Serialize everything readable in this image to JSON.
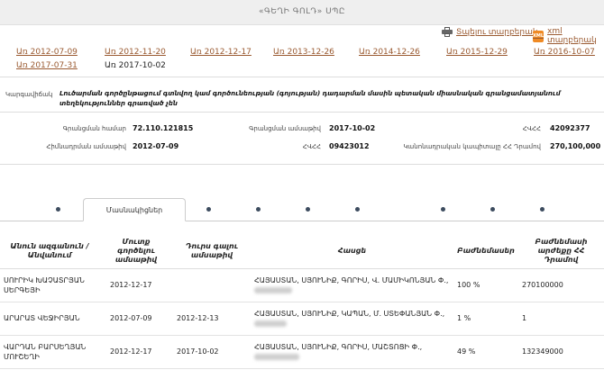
{
  "header": {
    "title": "«ԳԵՂԻ ԳՈԼԴ» ՍՊԸ"
  },
  "actions": {
    "print_label": "Տպելու տարբերակ",
    "xml_label": "xml տարբերակ",
    "xml_badge": "XML"
  },
  "dates": {
    "links": [
      "Առ 2012-07-09",
      "Առ 2012-11-20",
      "Առ 2012-12-17",
      "Առ 2013-12-26",
      "Առ 2014-12-26",
      "Առ 2015-12-29",
      "Առ 2016-10-07",
      "Առ 2017-07-31"
    ],
    "current": "Առ 2017-10-02"
  },
  "company": {
    "kind_label": "Կարգավիճակ",
    "kind_value": "Լուծարման գործընթացում գտնվող կամ գործունեության (գոյության) դադարման մասին պետական միասնական գրանցամատյանում տեղեկություններ գրառված չեն",
    "reg_number_label": "Գրանցման համար",
    "reg_number": "72.110.121815",
    "reg_date_label": "Գրանցման ամսաթիվ",
    "reg_date": "2017-10-02",
    "tin_label": "ՀՎՀՀ",
    "tin": "42092377",
    "creation_date_label": "Հիմնադրման ամսաթիվ",
    "creation_date": "2012-07-09",
    "hvhh_label": "ՀՎՀՀ",
    "hvhh": "09423012",
    "capital_label": "Կանոնադրական կապիտալը ՀՀ Դրամով",
    "capital": "270,100,000"
  },
  "tabs": {
    "active_label": "Մասնակիցներ"
  },
  "members_table": {
    "headers": {
      "name": "Անուն ազգանուն / Անվանում",
      "entry_date": "Մուտք գործելու ամսաթիվ",
      "exit_date": "Դուրս գալու ամսաթիվ",
      "address": "Հասցե",
      "share": "Բաժնեմասեր",
      "share_value": "Բաժնեմասի արժեքը ՀՀ Դրամով"
    },
    "rows": [
      {
        "name": "ՍՈՒՐԻԿ ԽԱՉԱՏՐՅԱՆ ՍԵՐԳԵՅԻ",
        "entry_date": "2012-12-17",
        "exit_date": "",
        "address": "ՀԱՅԱՍՏԱՆ, ՍՅՈՒՆԻՔ, ԳՈՐԻՍ, Վ. ՄԱՄԻԿՈՆՅԱՆ Փ.,",
        "share": "100 %",
        "share_value": "270100000"
      },
      {
        "name": "ԱՐԱՐԱՏ ՎԵՋԻՐՅԱՆ",
        "entry_date": "2012-07-09",
        "exit_date": "2012-12-13",
        "address": "ՀԱՅԱՍՏԱՆ, ՍՅՈՒՆԻՔ, ԿԱՊԱՆ, Մ. ՍՏԵՓԱՆՅԱՆ Փ.,",
        "share": "1 %",
        "share_value": "1"
      },
      {
        "name": "ՎԱՐԴԱՆ ԲԱՐՍԵՂՅԱՆ ՄՈՒՇԵՂԻ",
        "entry_date": "2012-12-17",
        "exit_date": "2017-10-02",
        "address": "ՀԱՅԱՍՏԱՆ, ՍՅՈՒՆԻՔ, ԳՈՐԻՍ, ՄԱՇՏՈՑԻ Փ.,",
        "share": "49 %",
        "share_value": "132349000"
      }
    ]
  }
}
